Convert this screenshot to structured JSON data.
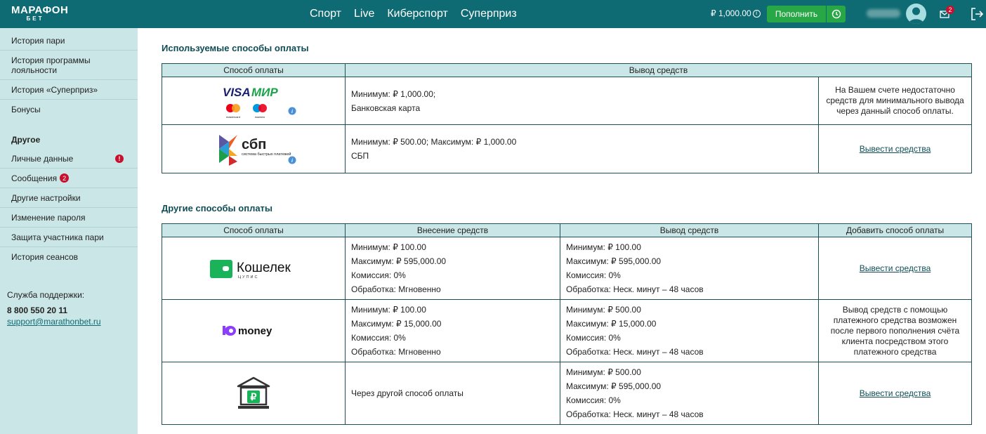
{
  "header": {
    "logo_main": "МАРАФОН",
    "logo_sub": "БЕТ",
    "nav": [
      "Спорт",
      "Live",
      "Киберспорт",
      "Суперприз"
    ],
    "balance": "₽ 1,000.00",
    "deposit_label": "Пополнить",
    "mail_count": "2"
  },
  "sidebar": {
    "items": [
      "История пари",
      "История программы лояльности",
      "История «Суперприз»",
      "Бонусы"
    ],
    "other_heading": "Другое",
    "other_items": [
      "Личные данные",
      "Сообщения",
      "Другие настройки",
      "Изменение пароля",
      "Защита участника пари",
      "История сеансов"
    ],
    "messages_count": "2",
    "support_label": "Служба поддержки:",
    "support_phone": "8 800 550 20 11",
    "support_email": "support@marathonbet.ru"
  },
  "used": {
    "title": "Используемые способы оплаты",
    "headers": [
      "Способ оплаты",
      "Вывод средств"
    ],
    "rows": [
      {
        "logo": "visa-mir-mastercard-maestro",
        "line1": "Минимум: ₽ 1,000.00;",
        "line2": "Банковская карта",
        "action": "На Вашем счете недостаточно средств для минимального вывода через данный способ оплаты."
      },
      {
        "logo": "sbp",
        "line1": "Минимум: ₽ 500.00; Максимум: ₽ 1,000.00",
        "line2": "СБП",
        "action": "Вывести средства"
      }
    ]
  },
  "other": {
    "title": "Другие способы оплаты",
    "headers": [
      "Способ оплаты",
      "Внесение средств",
      "Вывод средств",
      "Добавить способ оплаты"
    ],
    "rows": [
      {
        "logo": "koshelek",
        "deposit": [
          "Минимум: ₽ 100.00",
          "Максимум: ₽ 595,000.00",
          "Комиссия: 0%",
          "Обработка: Мгновенно"
        ],
        "withdraw": [
          "Минимум: ₽ 100.00",
          "Максимум: ₽ 595,000.00",
          "Комиссия: 0%",
          "Обработка: Неск. минут – 48 часов"
        ],
        "action": "Вывести средства"
      },
      {
        "logo": "yoomoney",
        "deposit": [
          "Минимум: ₽ 100.00",
          "Максимум: ₽ 15,000.00",
          "Комиссия: 0%",
          "Обработка: Мгновенно"
        ],
        "withdraw": [
          "Минимум: ₽ 500.00",
          "Максимум: ₽ 15,000.00",
          "Комиссия: 0%",
          "Обработка: Неск. минут – 48 часов"
        ],
        "action": "Вывод средств с помощью платежного средства возможен после первого пополнения счёта клиента посредством этого платежного средства"
      },
      {
        "logo": "bank",
        "deposit_text": "Через другой способ оплаты",
        "withdraw": [
          "Минимум: ₽ 500.00",
          "Максимум: ₽ 595,000.00",
          "Комиссия: 0%",
          "Обработка: Неск. минут – 48 часов"
        ],
        "action": "Вывести средства"
      }
    ]
  },
  "logos": {
    "visa": "VISA",
    "mir": "МИР",
    "mastercard": "mastercard",
    "maestro": "maestro",
    "sbp_main": "сбп",
    "sbp_sub": "система быстрых платежей",
    "koshelek_main": "Кошелек",
    "koshelek_sub": "ЦУПИС",
    "yoomoney": "money"
  },
  "colors": {
    "header_bg": "#0f6b73",
    "sidebar_bg": "#cbe6e6",
    "accent_green": "#27a745",
    "badge_red": "#c8102e"
  }
}
